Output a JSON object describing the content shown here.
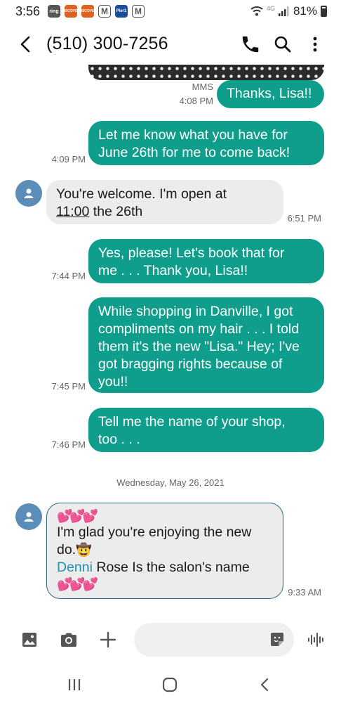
{
  "status_bar": {
    "time": "3:56",
    "notifications": [
      "ring",
      "DISCOVER",
      "DISCOVER",
      "M",
      "Pier1",
      "M"
    ],
    "network": "4G",
    "battery": "81%"
  },
  "header": {
    "title": "(510) 300-7256"
  },
  "messages": [
    {
      "type": "sent",
      "label": "MMS",
      "text": "Thanks, Lisa!!",
      "time": "4:08 PM"
    },
    {
      "type": "sent",
      "line1": "Let me know what you have for",
      "line2": "June 26th for me to come back!",
      "time": "4:09 PM"
    },
    {
      "type": "received",
      "line1": "You're welcome. I'm open at",
      "line2_link": "11:00",
      "line2_rest": " the 26th",
      "time": "6:51 PM"
    },
    {
      "type": "sent",
      "line1": "Yes, please!  Let's book that for",
      "line2": "me . . . Thank you, Lisa!!",
      "time": "7:44 PM"
    },
    {
      "type": "sent",
      "line1": "While shopping in Danville, I got",
      "line2": "compliments on my hair . . . I told",
      "line3": "them it's the new \"Lisa.\"  Hey; I've",
      "line4": "got bragging rights because of",
      "line5": "you!!",
      "time": "7:45 PM"
    },
    {
      "type": "sent",
      "line1": "Tell me the name of your shop,",
      "line2": "too . . .",
      "time": "7:46 PM"
    },
    {
      "type": "received",
      "hearts": "💕💕💕",
      "line1": "I'm glad you're enjoying the new",
      "line2": "do.",
      "line2_emoji": "🤠",
      "name": "Denni",
      "line3_rest": " Rose Is the salon's name",
      "hearts2": "💕💕💕",
      "time": "9:33 AM"
    }
  ],
  "date_separator": "Wednesday, May 26, 2021",
  "compose": {
    "placeholder": ""
  },
  "colors": {
    "sent_bubble": "#0f9e8c",
    "received_bubble": "#ececec",
    "avatar": "#5b8db9",
    "link": "#1f8fb6"
  },
  "icons": [
    "back-arrow-icon",
    "phone-icon",
    "search-icon",
    "more-vert-icon",
    "gallery-icon",
    "camera-icon",
    "plus-icon",
    "sticker-icon",
    "voice-icon",
    "recents-icon",
    "home-icon",
    "nav-back-icon",
    "person-icon"
  ]
}
